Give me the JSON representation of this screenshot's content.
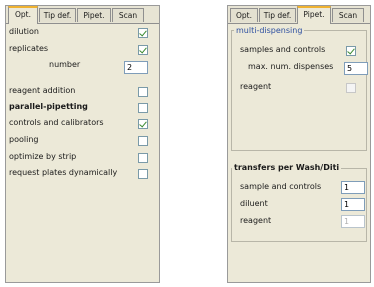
{
  "left": {
    "tabs": [
      "Opt.",
      "Tip def.",
      "Pipet.",
      "Scan"
    ],
    "options": {
      "dilution": "dilution",
      "replicates": "replicates",
      "number_label": "number",
      "number_value": "2",
      "reagent_addition": "reagent addition",
      "parallel_pipetting": "parallel-pipetting",
      "controls_and_calibrators": "controls and calibrators",
      "pooling": "pooling",
      "optimize_by_strip": "optimize by strip",
      "request_plates_dynamically": "request plates dynamically"
    },
    "checkbox_states": {
      "dilution": true,
      "replicates": true,
      "reagent_addition": false,
      "parallel_pipetting": false,
      "controls_and_calibrators": true,
      "pooling": false,
      "optimize_by_strip": false,
      "request_plates_dynamically": false
    }
  },
  "right": {
    "tabs": [
      "Opt.",
      "Tip def.",
      "Pipet.",
      "Scan"
    ],
    "multi_dispensing": {
      "title": "multi-dispensing",
      "samples_and_controls": "samples and controls",
      "max_num_dispenses_label": "max. num. dispenses",
      "max_num_dispenses_value": "5",
      "reagent": "reagent"
    },
    "transfers": {
      "title": "transfers per Wash/Diti",
      "sample_and_controls_label": "sample and controls",
      "sample_and_controls_value": "1",
      "diluent_label": "diluent",
      "diluent_value": "1",
      "reagent_label": "reagent",
      "reagent_value": "1"
    }
  },
  "colors": {
    "panel_bg": "#ece9d8",
    "active_tab_accent": "#f0b230",
    "check_green": "#3a8a30",
    "group_title_blue": "#2d4fa0"
  }
}
